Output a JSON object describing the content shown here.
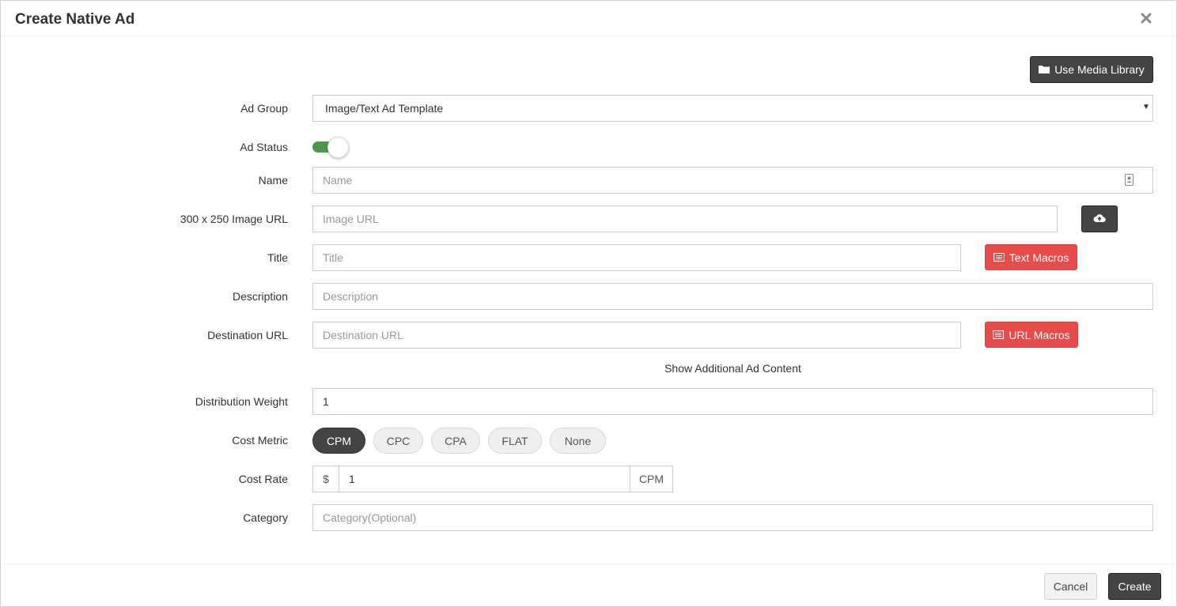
{
  "modal": {
    "title": "Create Native Ad",
    "close_icon": "close-icon"
  },
  "media_library": {
    "label": "Use Media Library",
    "icon": "folder-icon"
  },
  "fields": {
    "ad_group": {
      "label": "Ad Group",
      "value": "Image/Text Ad Template"
    },
    "ad_status": {
      "label": "Ad Status",
      "enabled": true,
      "color": "#4a9a4a"
    },
    "name": {
      "label": "Name",
      "placeholder": "Name",
      "icon": "contact-card-icon"
    },
    "image_url": {
      "label": "300 x 250 Image URL",
      "placeholder": "Image URL",
      "upload_icon": "cloud-upload-icon"
    },
    "title": {
      "label": "Title",
      "placeholder": "Title",
      "macros_label": "Text Macros"
    },
    "description": {
      "label": "Description",
      "placeholder": "Description"
    },
    "destination_url": {
      "label": "Destination URL",
      "placeholder": "Destination URL",
      "macros_label": "URL Macros"
    },
    "additional_content_link": "Show Additional Ad Content",
    "distribution_weight": {
      "label": "Distribution Weight",
      "value": "1"
    },
    "cost_metric": {
      "label": "Cost Metric",
      "options": [
        "CPM",
        "CPC",
        "CPA",
        "FLAT",
        "None"
      ],
      "selected": "CPM"
    },
    "cost_rate": {
      "label": "Cost Rate",
      "prefix": "$",
      "value": "1",
      "suffix": "CPM"
    },
    "category": {
      "label": "Category",
      "placeholder": "Category(Optional)"
    }
  },
  "footer": {
    "cancel_label": "Cancel",
    "create_label": "Create"
  },
  "colors": {
    "dark_button": "#444444",
    "macro_button": "#e94a4a",
    "toggle_on": "#4a9a4a"
  }
}
